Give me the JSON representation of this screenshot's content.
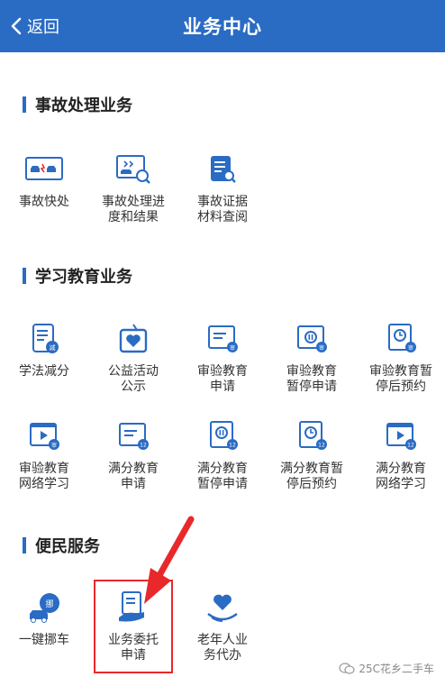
{
  "header": {
    "back_label": "返回",
    "title": "业务中心"
  },
  "sections": [
    {
      "title": "事故处理业务",
      "items": [
        {
          "label": "事故快处",
          "icon": "car-crash-icon"
        },
        {
          "label": "事故处理进\n度和结果",
          "icon": "accident-progress-icon"
        },
        {
          "label": "事故证据\n材料查阅",
          "icon": "document-search-icon"
        }
      ]
    },
    {
      "title": "学习教育业务",
      "items": [
        {
          "label": "学法减分",
          "icon": "study-book-icon"
        },
        {
          "label": "公益活动\n公示",
          "icon": "public-welfare-icon"
        },
        {
          "label": "审验教育\n申请",
          "icon": "review-apply-icon"
        },
        {
          "label": "审验教育\n暂停申请",
          "icon": "review-pause-icon"
        },
        {
          "label": "审验教育暂\n停后预约",
          "icon": "review-appointment-icon"
        },
        {
          "label": "审验教育\n网络学习",
          "icon": "review-online-icon"
        },
        {
          "label": "满分教育\n申请",
          "icon": "fullscore-apply-icon"
        },
        {
          "label": "满分教育\n暂停申请",
          "icon": "fullscore-pause-icon"
        },
        {
          "label": "满分教育暂\n停后预约",
          "icon": "fullscore-appointment-icon"
        },
        {
          "label": "满分教育\n网络学习",
          "icon": "fullscore-online-icon"
        }
      ]
    },
    {
      "title": "便民服务",
      "items": [
        {
          "label": "一键挪车",
          "icon": "move-car-icon"
        },
        {
          "label": "业务委托\n申请",
          "icon": "delegate-hand-icon"
        },
        {
          "label": "老年人业\n务代办",
          "icon": "elderly-heart-icon"
        }
      ]
    }
  ],
  "watermark": "25C花乡二手车",
  "colors": {
    "primary": "#2a6bc4",
    "accent": "#e8282b"
  }
}
